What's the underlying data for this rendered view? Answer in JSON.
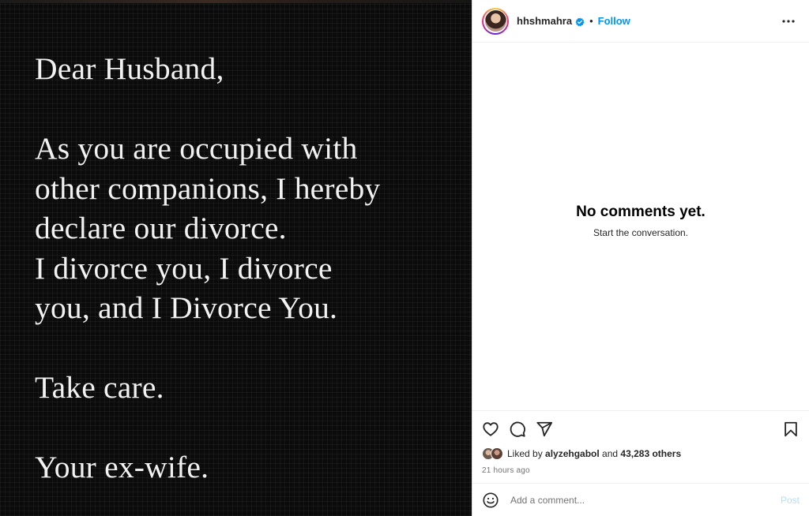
{
  "post_image": {
    "lines": [
      "Dear Husband,",
      "",
      "As you are occupied with",
      "other companions, I hereby",
      "declare our divorce.",
      "I divorce you, I divorce",
      "you, and I Divorce You.",
      "",
      "Take care.",
      "",
      "Your ex-wife."
    ]
  },
  "header": {
    "username": "hhshmahra",
    "separator": "•",
    "follow_label": "Follow"
  },
  "comments": {
    "empty_title": "No comments yet.",
    "empty_subtitle": "Start the conversation."
  },
  "likes": {
    "prefix": "Liked by ",
    "liker": "alyzehgabol",
    "middle": " and ",
    "others": "43,283 others"
  },
  "timestamp": "21 hours ago",
  "add_comment": {
    "placeholder": "Add a comment...",
    "post_label": "Post"
  },
  "colors": {
    "accent": "#0095f6",
    "post_disabled": "#b2dffc",
    "image_bg": "#0b0b0b",
    "letter_text": "#f2f2f2"
  },
  "icons": [
    "verified-badge-icon",
    "more-options-icon",
    "heart-icon",
    "comment-icon",
    "share-icon",
    "bookmark-icon",
    "emoji-icon"
  ]
}
